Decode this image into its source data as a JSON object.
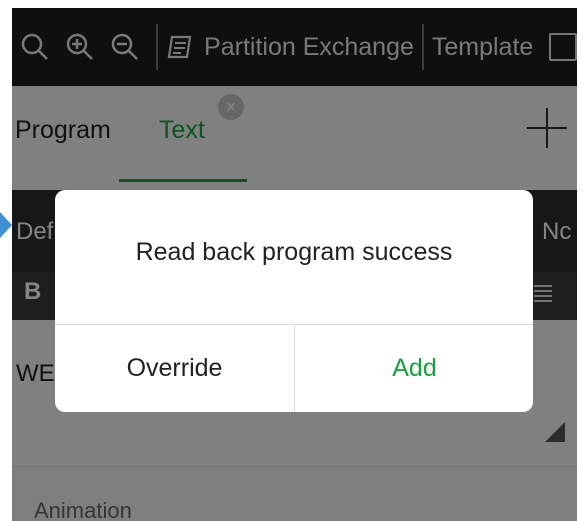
{
  "toolbar": {
    "icons": [
      "search-icon",
      "zoom-in-icon",
      "zoom-out-icon"
    ],
    "partition_exchange": "Partition Exchange",
    "template": "Template"
  },
  "tabs": {
    "program": "Program",
    "text": "Text",
    "close_glyph": "×"
  },
  "background": {
    "def_label": "Def",
    "nc_label": "Nc",
    "bold_label": "B",
    "editor_text": "WEl",
    "animation_label": "Animation"
  },
  "dialog": {
    "message": "Read back program success",
    "override_label": "Override",
    "add_label": "Add"
  },
  "colors": {
    "accent": "#1aa33c",
    "toolbar_bg": "#1e1e1e"
  }
}
